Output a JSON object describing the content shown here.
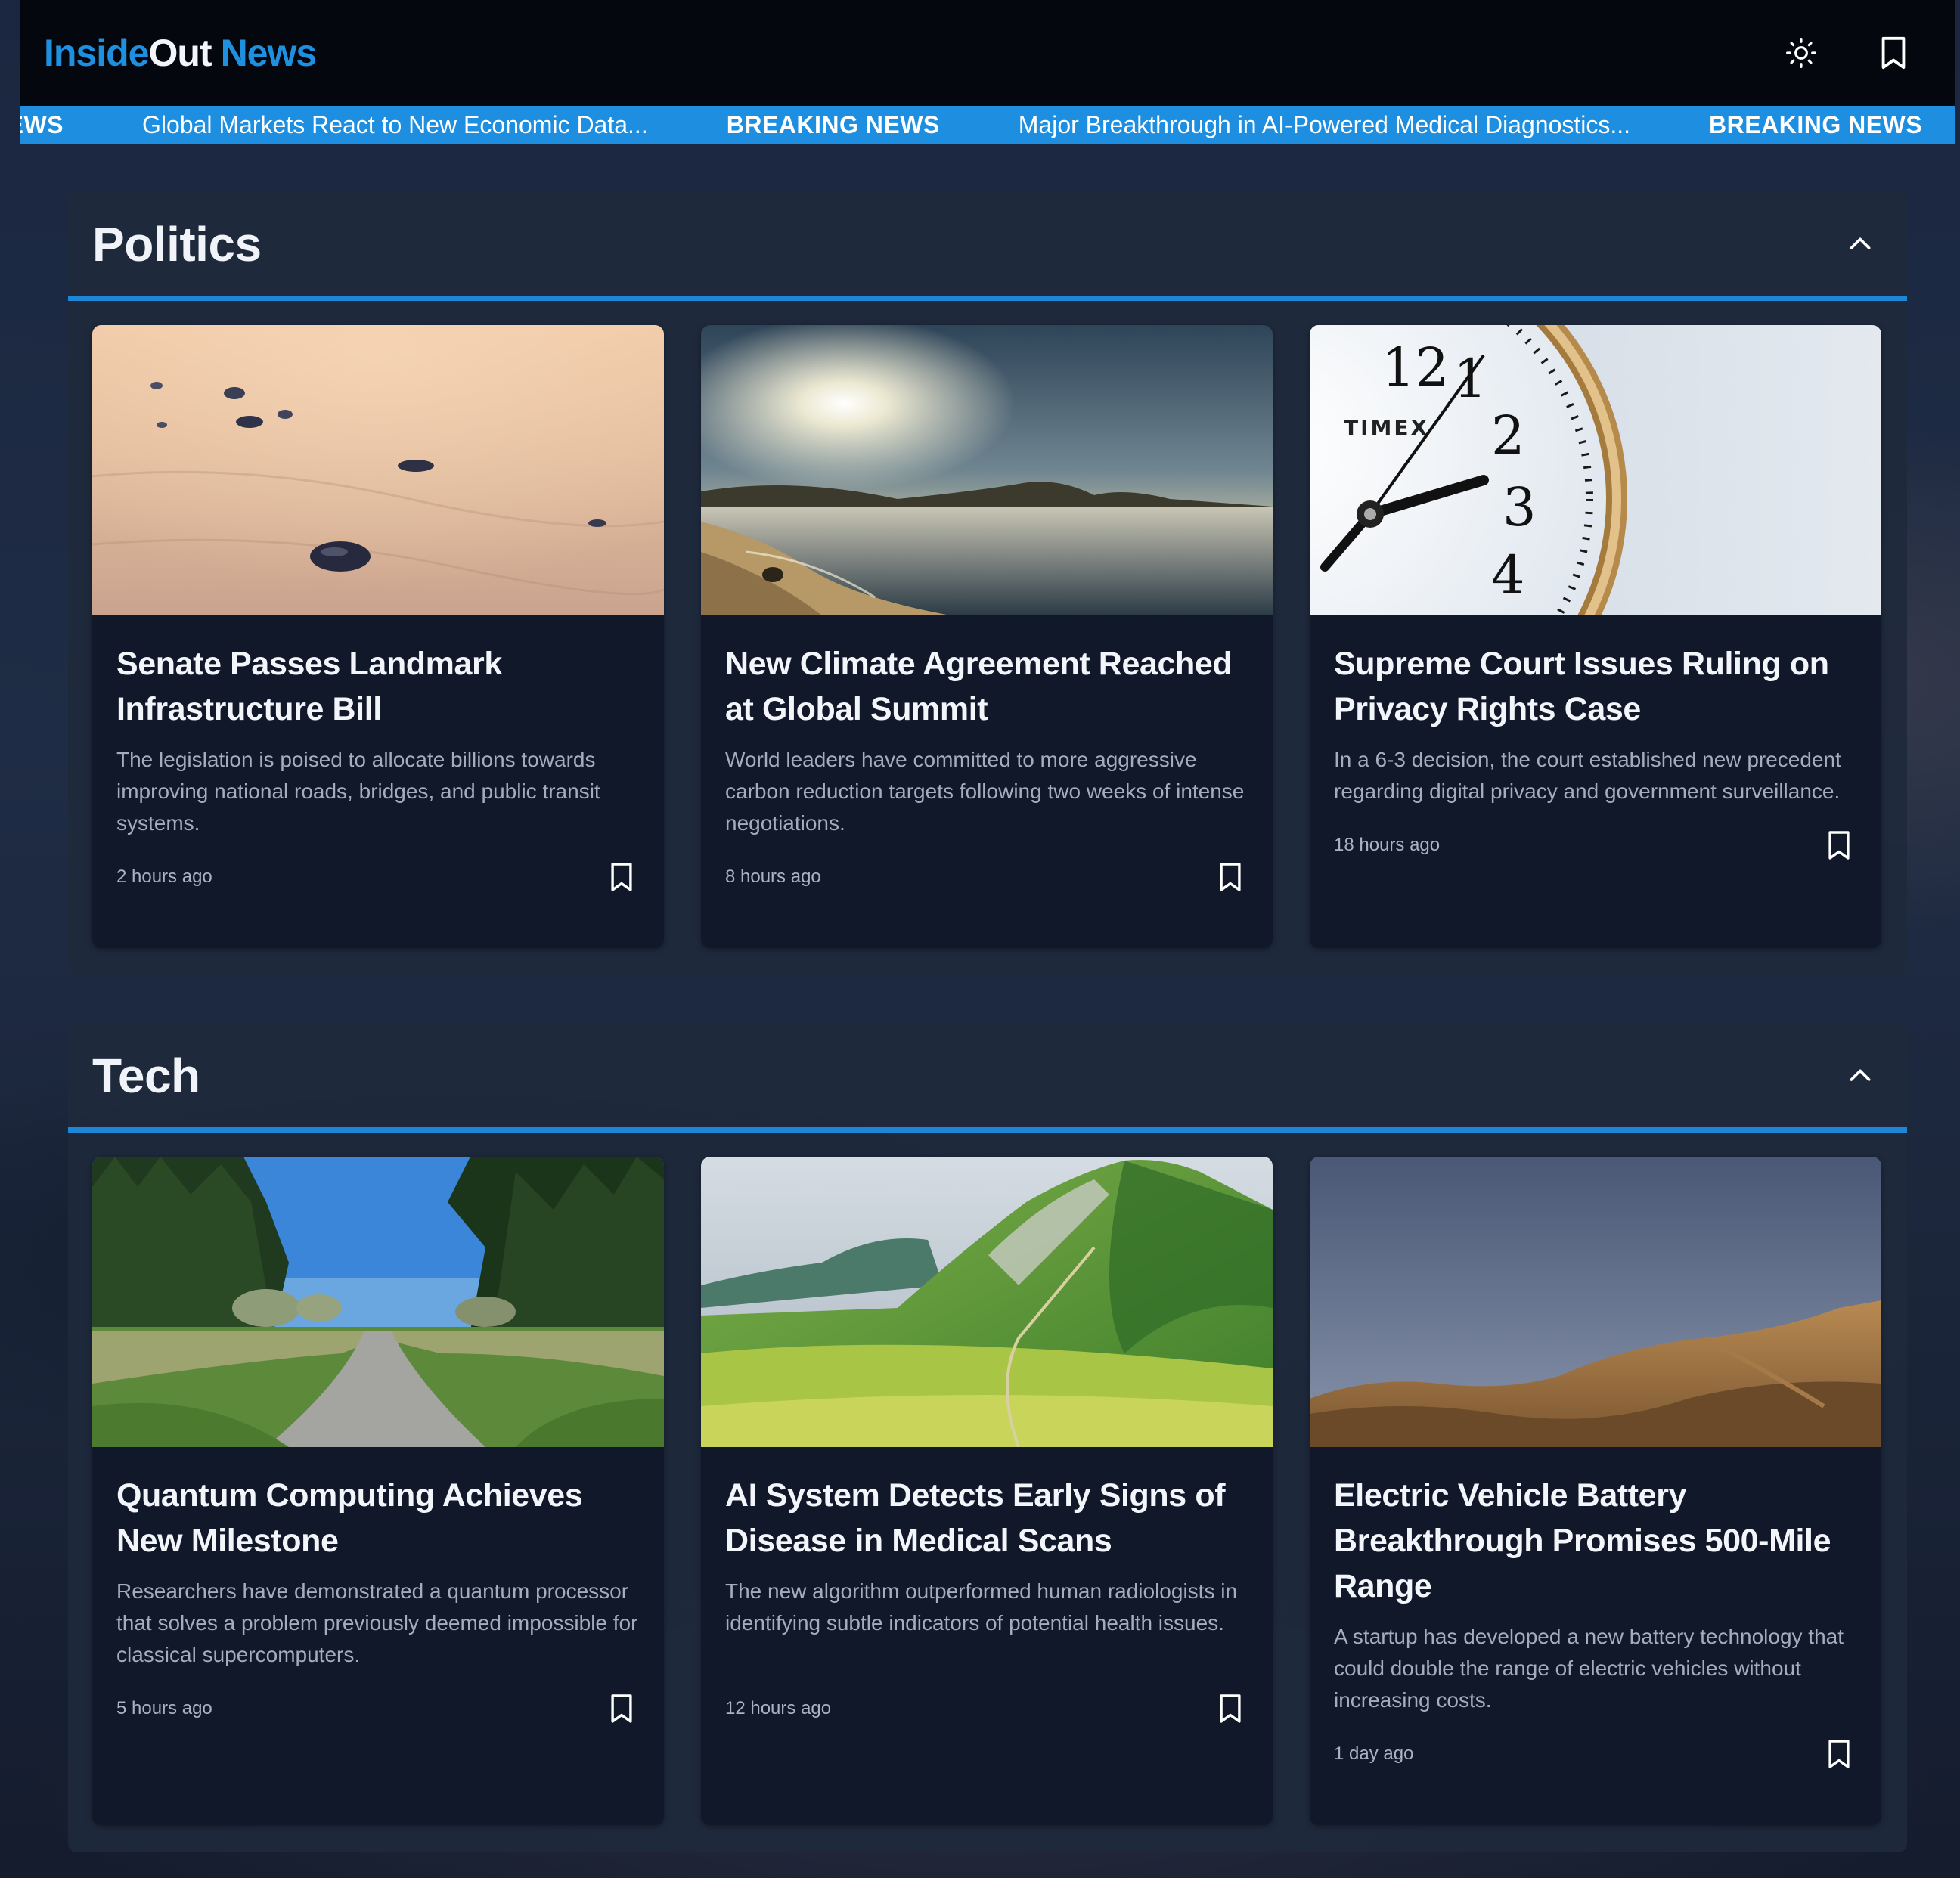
{
  "header": {
    "logo_part1": "Inside",
    "logo_part2": "Out",
    "logo_part3": "News",
    "theme_icon": "sun-icon",
    "bookmarks_icon": "bookmark-icon"
  },
  "ticker": {
    "items": [
      {
        "label": "NEWS"
      },
      {
        "text": "Global Markets React to New Economic Data..."
      },
      {
        "label": "BREAKING NEWS"
      },
      {
        "text": "Major Breakthrough in AI-Powered Medical Diagnostics..."
      },
      {
        "label": "BREAKING NEWS"
      }
    ]
  },
  "colors": {
    "accent": "#1e8fe0",
    "topbar": "#04070d",
    "card_bg": "#101829",
    "section_bg": "#1e293c"
  },
  "sections": [
    {
      "title": "Politics",
      "collapse_icon": "chevron-up-icon",
      "articles": [
        {
          "image": "sand-pebbles",
          "title": "Senate Passes Landmark Infrastructure Bill",
          "description": "The legislation is poised to allocate billions towards improving national roads, bridges, and public transit systems.",
          "time": "2 hours ago"
        },
        {
          "image": "sunlit-coast",
          "title": "New Climate Agreement Reached at Global Summit",
          "description": "World leaders have committed to more aggressive carbon reduction targets following two weeks of intense negotiations.",
          "time": "8 hours ago"
        },
        {
          "image": "timex-clock",
          "title": "Supreme Court Issues Ruling on Privacy Rights Case",
          "description": "In a 6-3 decision, the court established new precedent regarding digital privacy and government surveillance.",
          "time": "18 hours ago",
          "clock_brand": "TIMEX",
          "clock_numbers": [
            "12",
            "1",
            "2",
            "3",
            "4"
          ]
        }
      ]
    },
    {
      "title": "Tech",
      "collapse_icon": "chevron-up-icon",
      "articles": [
        {
          "image": "forest-path",
          "title": "Quantum Computing Achieves New Milestone",
          "description": "Researchers have demonstrated a quantum processor that solves a problem previously deemed impossible for classical supercomputers.",
          "time": "5 hours ago"
        },
        {
          "image": "green-mountain",
          "title": "AI System Detects Early Signs of Disease in Medical Scans",
          "description": "The new algorithm outperformed human radiologists in identifying subtle indicators of potential health issues.",
          "time": "12 hours ago"
        },
        {
          "image": "desert-hills",
          "title": "Electric Vehicle Battery Breakthrough Promises 500-Mile Range",
          "description": "A startup has developed a new battery technology that could double the range of electric vehicles without increasing costs.",
          "time": "1 day ago"
        }
      ]
    }
  ]
}
